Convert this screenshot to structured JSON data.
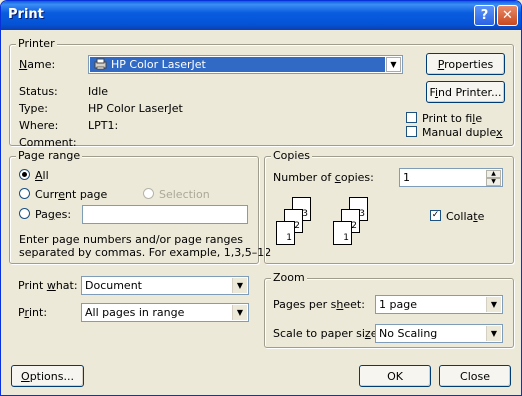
{
  "window": {
    "title": "Print",
    "help_glyph": "?",
    "close_glyph": "✕"
  },
  "printer": {
    "legend": "Printer",
    "name_label": "Name:",
    "name_value": "HP Color LaserJet",
    "properties_button": "Properties",
    "find_printer_button": "Find Printer...",
    "status_label": "Status:",
    "status_value": "Idle",
    "type_label": "Type:",
    "type_value": "HP Color LaserJet",
    "where_label": "Where:",
    "where_value": "LPT1:",
    "comment_label": "Comment:",
    "comment_value": "",
    "print_to_file_label": "Print to file",
    "print_to_file_checked": false,
    "manual_duplex_label": "Manual duplex",
    "manual_duplex_checked": false
  },
  "page_range": {
    "legend": "Page range",
    "all_label": "All",
    "current_page_label": "Current page",
    "selection_label": "Selection",
    "pages_label": "Pages:",
    "pages_value": "",
    "selected": "all",
    "help_line1": "Enter page numbers and/or page ranges",
    "help_line2": "separated by commas.  For example, 1,3,5–12"
  },
  "copies": {
    "legend": "Copies",
    "number_label": "Number of copies:",
    "number_value": "1",
    "collate_label": "Collate",
    "collate_checked": true,
    "collate_pages_a": [
      "1",
      "2",
      "3"
    ],
    "collate_pages_b": [
      "1",
      "2",
      "3"
    ]
  },
  "print_what": {
    "label": "Print what:",
    "value": "Document",
    "print_label": "Print:",
    "print_value": "All pages in range"
  },
  "zoom": {
    "legend": "Zoom",
    "pages_per_sheet_label": "Pages per sheet:",
    "pages_per_sheet_value": "1 page",
    "scale_label": "Scale to paper size:",
    "scale_value": "No Scaling"
  },
  "footer": {
    "options_button": "Options...",
    "ok_button": "OK",
    "close_button": "Close"
  },
  "colors": {
    "titlebar": "#0a5ddf",
    "face": "#ece9d8",
    "selection": "#316ac5"
  }
}
